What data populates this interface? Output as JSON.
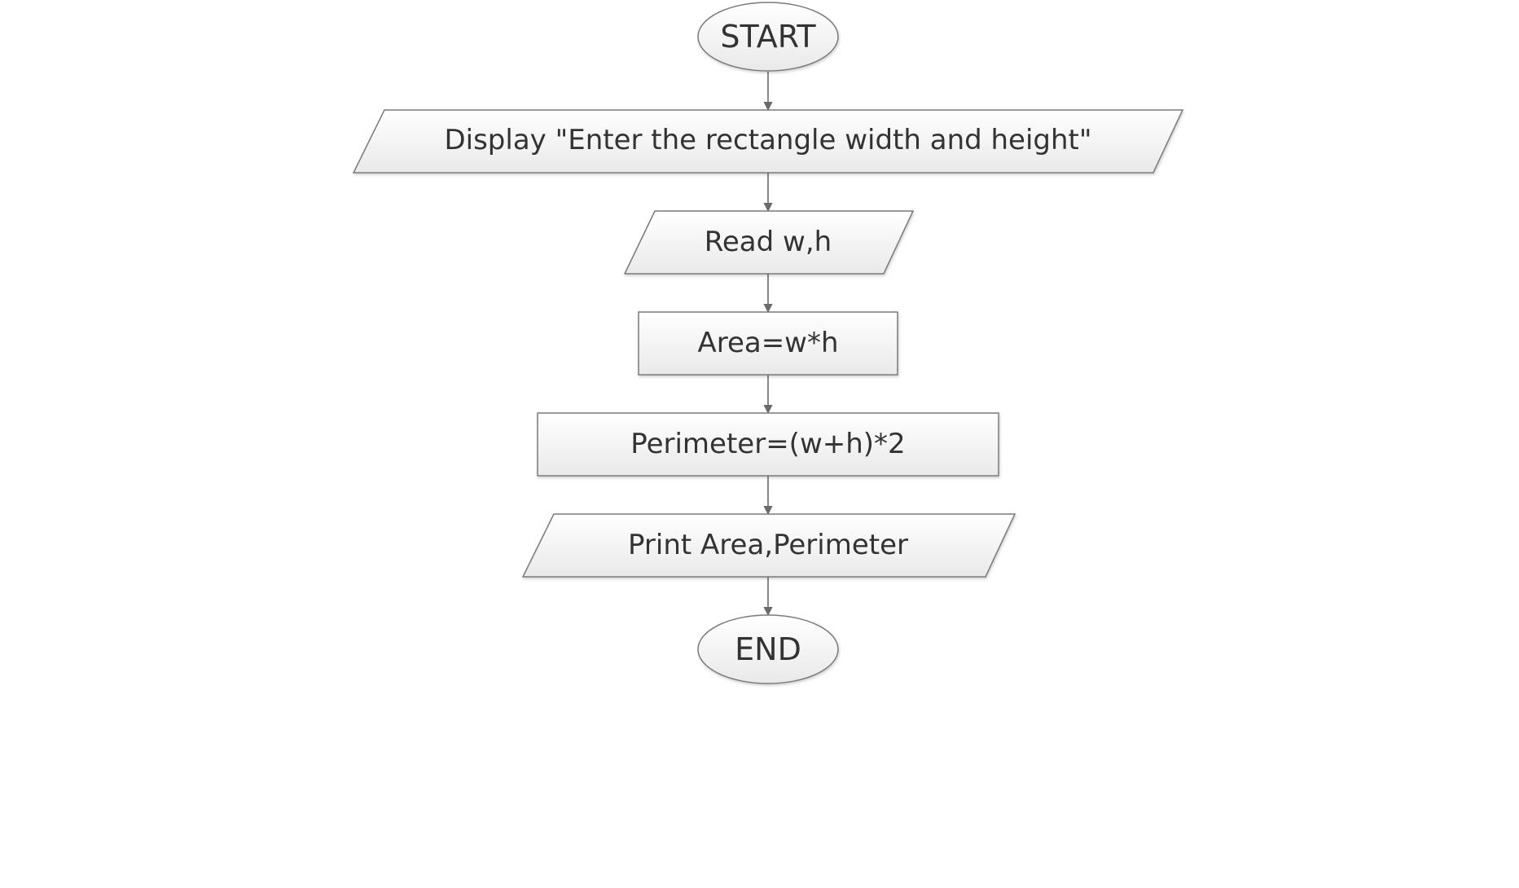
{
  "flowchart": {
    "nodes": [
      {
        "id": "start",
        "shape": "terminator",
        "label": "START"
      },
      {
        "id": "display",
        "shape": "io",
        "label": "Display \"Enter the rectangle width and height\""
      },
      {
        "id": "read",
        "shape": "io",
        "label": "Read w,h"
      },
      {
        "id": "area",
        "shape": "process",
        "label": "Area=w*h"
      },
      {
        "id": "perimeter",
        "shape": "process",
        "label": "Perimeter=(w+h)*2"
      },
      {
        "id": "print",
        "shape": "io",
        "label": "Print Area,Perimeter"
      },
      {
        "id": "end",
        "shape": "terminator",
        "label": "END"
      }
    ],
    "edges": [
      {
        "from": "start",
        "to": "display"
      },
      {
        "from": "display",
        "to": "read"
      },
      {
        "from": "read",
        "to": "area"
      },
      {
        "from": "area",
        "to": "perimeter"
      },
      {
        "from": "perimeter",
        "to": "print"
      },
      {
        "from": "print",
        "to": "end"
      }
    ]
  }
}
